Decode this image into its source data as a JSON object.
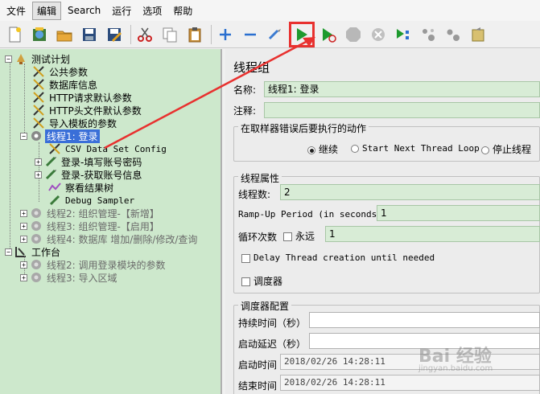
{
  "menu": [
    {
      "id": "file",
      "label": "文件"
    },
    {
      "id": "edit",
      "label": "编辑",
      "active": true
    },
    {
      "id": "search",
      "label": "Search"
    },
    {
      "id": "run",
      "label": "运行"
    },
    {
      "id": "options",
      "label": "选项"
    },
    {
      "id": "help",
      "label": "帮助"
    }
  ],
  "toolbar": {
    "icons": [
      "new-file-icon",
      "templates-icon",
      "open-icon",
      "save-icon",
      "save-as-icon",
      "cut-icon",
      "copy-icon",
      "paste-icon",
      "expand-icon",
      "collapse-icon",
      "toggle-icon",
      "start-icon",
      "start-no-pause-icon",
      "stop-icon",
      "shutdown-icon",
      "remote-start-icon",
      "clear-icon",
      "clear-all-icon",
      "function-helper-icon"
    ]
  },
  "tree": {
    "test_plan": "测试计划",
    "items": [
      {
        "label": "公共参数"
      },
      {
        "label": "数据库信息"
      },
      {
        "label": "HTTP请求默认参数"
      },
      {
        "label": "HTTP头文件默认参数"
      },
      {
        "label": "导入模板的参数"
      }
    ],
    "thread1": "线程1: 登录",
    "thread1_children": [
      {
        "label": "CSV Data Set Config"
      },
      {
        "label": "登录-填写账号密码"
      },
      {
        "label": "登录-获取账号信息"
      },
      {
        "label": "察看结果树"
      },
      {
        "label": "Debug Sampler"
      }
    ],
    "threads_other": [
      {
        "label": "线程2: 组织管理-【新增】"
      },
      {
        "label": "线程3: 组织管理-【启用】"
      },
      {
        "label": "线程4: 数据库 增加/删除/修改/查询"
      }
    ],
    "workbench": "工作台",
    "workbench_children": [
      {
        "label": "线程2: 调用登录模块的参数"
      },
      {
        "label": "线程3: 导入区域"
      }
    ]
  },
  "panel": {
    "title": "线程组",
    "name_label": "名称:",
    "name_value": "线程1: 登录",
    "comment_label": "注释:",
    "comment_value": "",
    "error_group": "在取样器错误后要执行的动作",
    "error_options": [
      "继续",
      "Start Next Thread Loop",
      "停止线程"
    ],
    "thread_props": "线程属性",
    "threads_label": "线程数:",
    "threads_value": "2",
    "rampup_label": "Ramp-Up Period (in seconds):",
    "rampup_value": "1",
    "loop_label": "循环次数",
    "forever_label": "永远",
    "loop_value": "1",
    "delay_label": "Delay Thread creation until needed",
    "scheduler_label": "调度器",
    "scheduler_config": "调度器配置",
    "duration_label": "持续时间（秒）",
    "startup_delay_label": "启动延迟（秒）",
    "start_time_label": "启动时间",
    "start_time_value": "2018/02/26 14:28:11",
    "end_time_label": "结束时间",
    "end_time_value": "2018/02/26 14:28:11"
  },
  "watermark": {
    "text": "Bai 经验",
    "sub": "jingyan.baidu.com"
  },
  "colors": {
    "tree_bg": "#cde8cc",
    "field_bg": "#d8ecd6",
    "selection": "#3a6fd8",
    "highlight_red": "#e8312f",
    "start_green": "#1e9a2e"
  }
}
